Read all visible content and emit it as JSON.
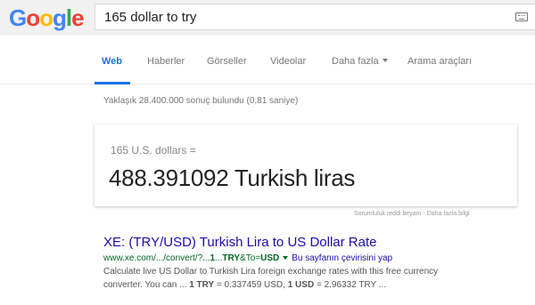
{
  "header": {
    "logo_text": "Google",
    "search_query": "165 dollar to try",
    "keyboard_icon": "keyboard-icon"
  },
  "tabs": [
    {
      "label": "Web",
      "active": true
    },
    {
      "label": "Haberler",
      "active": false
    },
    {
      "label": "Görseller",
      "active": false
    },
    {
      "label": "Videolar",
      "active": false
    },
    {
      "label": "Daha fazla",
      "active": false,
      "has_dropdown": true
    },
    {
      "label": "Arama araçları",
      "active": false
    }
  ],
  "stats_text": "Yaklaşık 28.400.000 sonuç bulundu (0,81 saniye)",
  "converter": {
    "from_text": "165 U.S. dollars =",
    "result_text": "488.391092 Turkish liras"
  },
  "disclaimer": "Sorumluluk reddi beyanı - Daha fazla bilgi",
  "result": {
    "title": "XE: (TRY/USD) Turkish Lira to US Dollar Rate",
    "url_prefix": "www.xe.com/.../convert/?...",
    "url_bold1": "1",
    "url_mid": "...",
    "url_bold2": "TRY",
    "url_mid2": "&To=",
    "url_bold3": "USD",
    "translate_label": "Bu sayfanın çevirisini yap",
    "snippet_line1": "Calculate live US Dollar to Turkish Lira foreign exchange rates with this free currency",
    "snippet_l2_a": "converter. You can ... ",
    "snippet_l2_b": "1 TRY",
    "snippet_l2_c": " = 0.337459 USD, ",
    "snippet_l2_d": "1 USD",
    "snippet_l2_e": " = 2.96332 TRY ..."
  },
  "colors": {
    "link_blue": "#1a0dab",
    "url_green": "#006621",
    "active_tab": "#1a73e8"
  }
}
